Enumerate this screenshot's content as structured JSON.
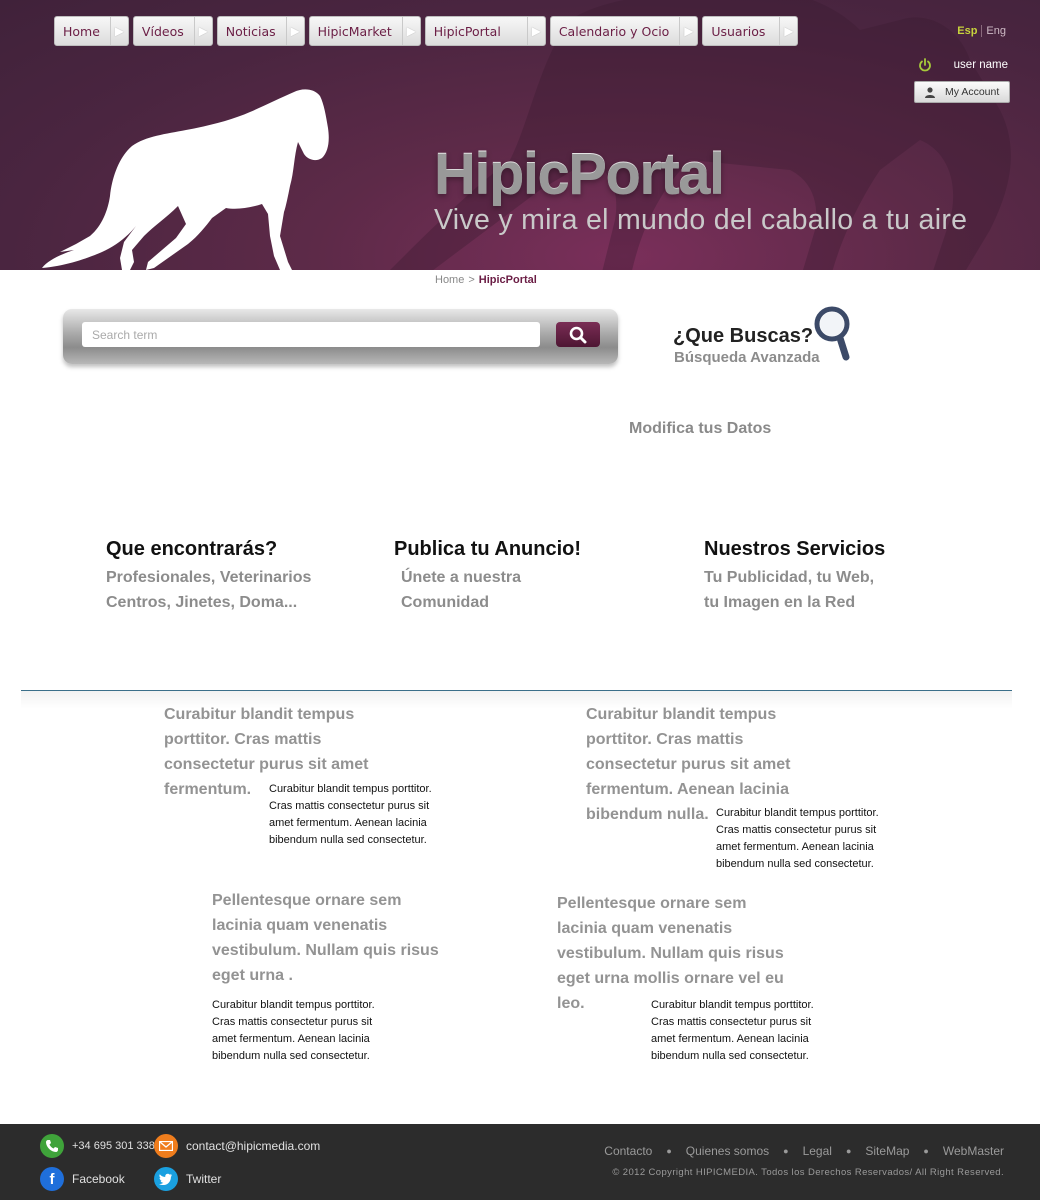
{
  "nav": {
    "items": [
      {
        "label": "Home"
      },
      {
        "label": "Vídeos"
      },
      {
        "label": "Noticias"
      },
      {
        "label": "HipicMarket"
      },
      {
        "label": "HipicPortal"
      },
      {
        "label": "Calendario y Ocio"
      },
      {
        "label": "Usuarios"
      }
    ]
  },
  "lang": {
    "esp": "Esp",
    "eng": "Eng"
  },
  "user": {
    "name": "user name",
    "account_label": "My Account"
  },
  "brand": {
    "title": "HipicPortal",
    "tagline": "Vive y mira el mundo del caballo a tu aire"
  },
  "breadcrumb": {
    "home": "Home",
    "sep": ">",
    "current": "HipicPortal"
  },
  "search": {
    "placeholder": "Search term"
  },
  "advanced": {
    "title": "¿Que Buscas?",
    "subtitle": "Búsqueda Avanzada"
  },
  "modifica": "Modifica tus Datos",
  "features": [
    {
      "title": "Que encontrarás?",
      "line1": "Profesionales, Veterinarios",
      "line2": "Centros, Jinetes, Doma..."
    },
    {
      "title": "Publica tu Anuncio!",
      "line1": "Únete a nuestra",
      "line2": "Comunidad"
    },
    {
      "title": "Nuestros Servicios",
      "line1": "Tu Publicidad, tu Web,",
      "line2": "tu Imagen en la Red"
    }
  ],
  "blocks": {
    "b1_big": [
      "Curabitur blandit tempus",
      "porttitor. Cras mattis",
      "consectetur purus sit amet",
      "fermentum."
    ],
    "b2_big": [
      "Curabitur blandit tempus",
      "porttitor. Cras mattis",
      "consectetur purus sit amet",
      "fermentum. Aenean lacinia",
      "bibendum nulla."
    ],
    "b3_big": [
      "Pellentesque ornare sem",
      "lacinia quam venenatis",
      "vestibulum. Nullam quis risus",
      "eget urna ."
    ],
    "b4_big": [
      "Pellentesque ornare sem",
      "lacinia quam venenatis",
      "vestibulum. Nullam quis risus",
      "eget urna mollis ornare vel eu",
      "leo."
    ],
    "small": [
      "Curabitur blandit tempus porttitor.",
      "Cras mattis consectetur purus sit",
      "amet fermentum. Aenean lacinia",
      "bibendum nulla sed consectetur."
    ]
  },
  "footer": {
    "phone": "+34 695 301 338",
    "email": "contact@hipicmedia.com",
    "facebook": "Facebook",
    "twitter": "Twitter",
    "links": [
      "Contacto",
      "Quienes somos",
      "Legal",
      "SiteMap",
      "WebMaster"
    ],
    "copyright": "© 2012 Copyright HIPICMEDIA. Todos los Derechos Reservados/ All Right Reserved."
  },
  "colors": {
    "brand_purple": "#5d2a48",
    "accent_green": "#c6d23c",
    "footer_bg": "#2c2c2c"
  }
}
